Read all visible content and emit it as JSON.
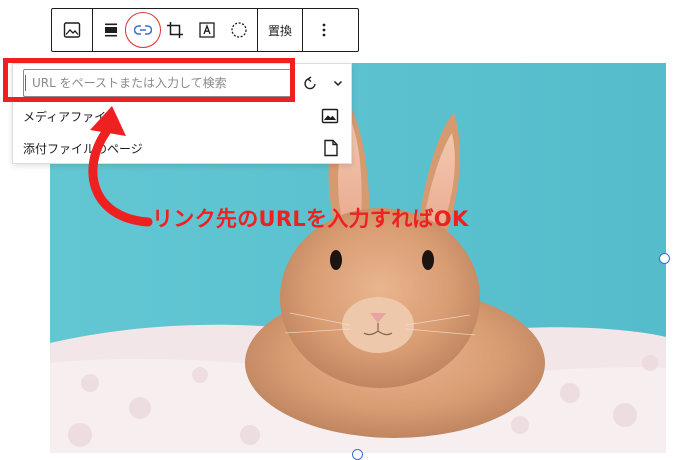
{
  "toolbar": {
    "buttons": [
      {
        "name": "image-block-switcher",
        "icon": "image-icon"
      },
      {
        "name": "align",
        "icon": "align-center-icon"
      },
      {
        "name": "link",
        "icon": "link-icon"
      },
      {
        "name": "crop",
        "icon": "crop-icon"
      },
      {
        "name": "text-overlay",
        "icon": "text-overlay-icon"
      },
      {
        "name": "duotone",
        "icon": "duotone-icon"
      }
    ],
    "replace_label": "置換",
    "more_icon": "more-vertical-icon"
  },
  "link_popover": {
    "url_placeholder": "URL をペーストまたは入力して検索",
    "url_value": "",
    "submit_icon": "enter-icon",
    "toggle_icon": "chevron-down-icon",
    "options": [
      {
        "label": "メディアファイル",
        "icon": "image-icon"
      },
      {
        "label": "添付ファイルのページ",
        "icon": "page-icon"
      }
    ]
  },
  "annotation": {
    "text": "リンク先のURLを入力すればOK",
    "color": "#ee2020"
  },
  "image": {
    "subject": "rabbit",
    "background_color": "#5fc3cf"
  },
  "colors": {
    "accent": "#3a6fd0",
    "annotation_red": "#ee2020",
    "toolbar_border": "#1e1e1e"
  }
}
